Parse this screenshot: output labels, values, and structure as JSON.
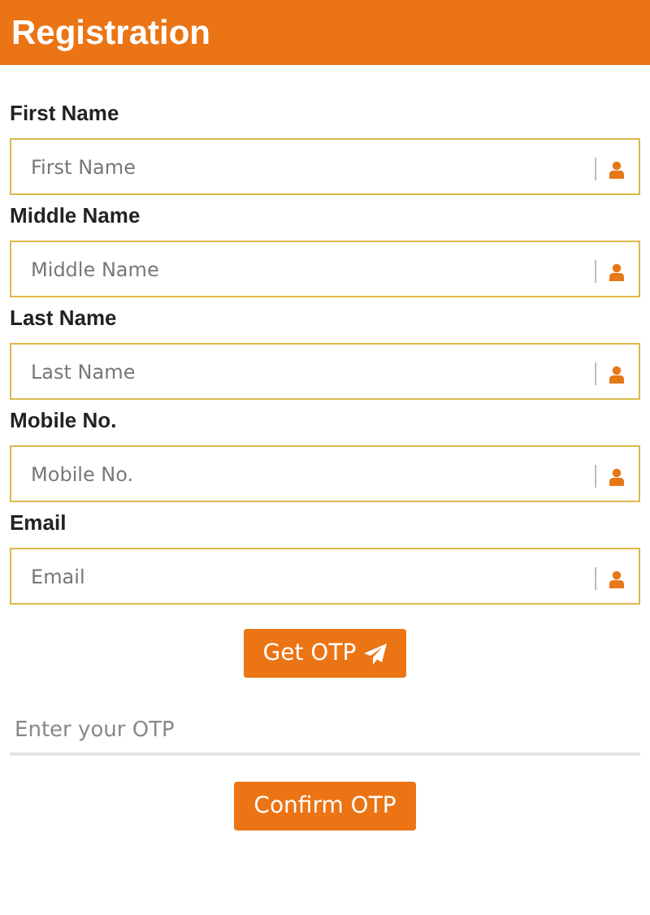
{
  "header": {
    "title": "Registration"
  },
  "fields": [
    {
      "label": "First Name",
      "placeholder": "First Name"
    },
    {
      "label": "Middle Name",
      "placeholder": "Middle Name"
    },
    {
      "label": "Last Name",
      "placeholder": "Last Name"
    },
    {
      "label": "Mobile No.",
      "placeholder": "Mobile No."
    },
    {
      "label": "Email",
      "placeholder": "Email"
    }
  ],
  "get_otp_button": "Get OTP",
  "otp_field": {
    "placeholder": "Enter your OTP"
  },
  "confirm_button": "Confirm OTP"
}
